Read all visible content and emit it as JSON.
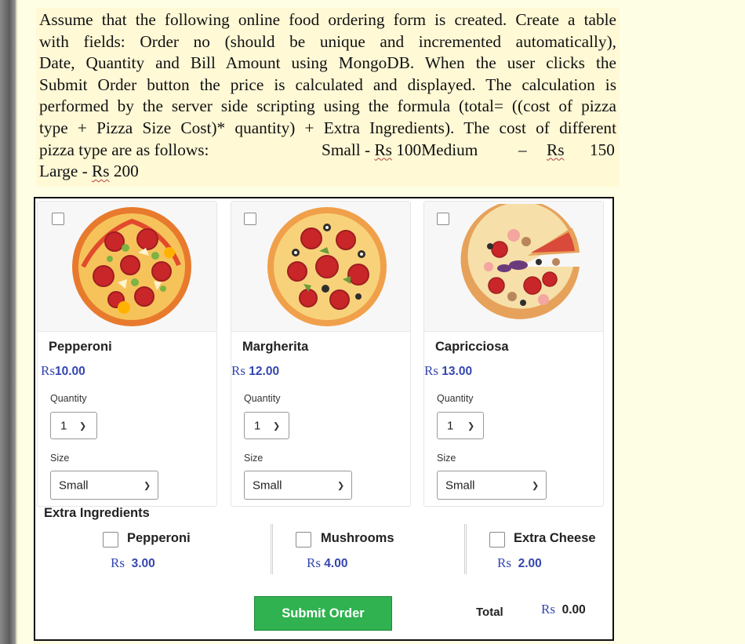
{
  "question": {
    "line1": "Assume that the following online food ordering form is created. Create a table",
    "line2": "with fields: Order no (should be unique and incremented automatically),",
    "line3": "Date, Quantity and Bill Amount using MongoDB. When the user clicks the",
    "line4": "Submit Order button the price is calculated and displayed. The calculation is",
    "line5": "performed by the server side scripting using the formula (total= ((cost of pizza",
    "line6": "type + Pizza Size Cost)* quantity) + Extra Ingredients). The cost of different",
    "line7_a": "pizza type are as follows:",
    "line7_b": "Small - ",
    "line7_rs1": "Rs",
    "line7_c": " 100Medium",
    "line7_dash": "–",
    "line7_rs2": "Rs",
    "line7_d": "150",
    "line8_a": "Large - ",
    "line8_rs": "Rs",
    "line8_b": " 200"
  },
  "form": {
    "pizzas": [
      {
        "name": "Pepperoni",
        "currency": "Rs",
        "price": "10.00",
        "quantity_label": "Quantity",
        "quantity": "1",
        "size_label": "Size",
        "size": "Small"
      },
      {
        "name": "Margherita",
        "currency": "Rs",
        "price": " 12.00",
        "quantity_label": "Quantity",
        "quantity": "1",
        "size_label": "Size",
        "size": "Small"
      },
      {
        "name": "Capricciosa",
        "currency": "Rs",
        "price": " 13.00",
        "quantity_label": "Quantity",
        "quantity": "1",
        "size_label": "Size",
        "size": "Small"
      }
    ],
    "extra_title": "Extra Ingredients",
    "ingredients": [
      {
        "name": "Pepperoni",
        "currency": "Rs",
        "price": "3.00"
      },
      {
        "name": "Mushrooms",
        "currency": "Rs",
        "price": "4.00"
      },
      {
        "name": "Extra Cheese",
        "currency": "Rs",
        "price": "2.00"
      }
    ],
    "submit_label": "Submit Order",
    "total_label": "Total",
    "total_currency": "Rs",
    "total_value": "0.00"
  },
  "colors": {
    "page_background": "#fefee4",
    "question_background": "#fff9d6",
    "price_blue": "#3446b0",
    "submit_green": "#2fb24f"
  }
}
